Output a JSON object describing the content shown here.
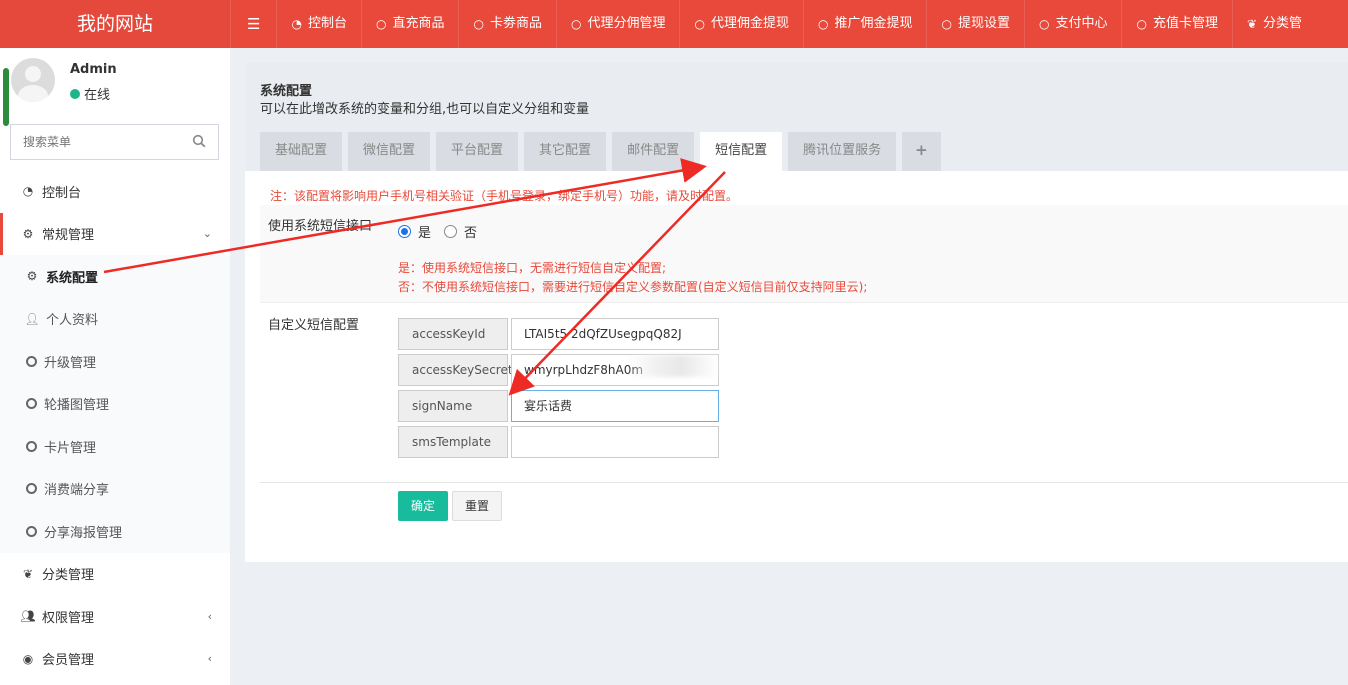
{
  "brand": "我的网站",
  "topnav": [
    {
      "icon": "dashboard",
      "label": "控制台"
    },
    {
      "icon": "circle",
      "label": "直充商品"
    },
    {
      "icon": "circle",
      "label": "卡劵商品"
    },
    {
      "icon": "circle",
      "label": "代理分佣管理"
    },
    {
      "icon": "circle",
      "label": "代理佣金提现"
    },
    {
      "icon": "circle",
      "label": "推广佣金提现"
    },
    {
      "icon": "circle",
      "label": "提现设置"
    },
    {
      "icon": "circle",
      "label": "支付中心"
    },
    {
      "icon": "circle",
      "label": "充值卡管理"
    },
    {
      "icon": "leaf",
      "label": "分类管"
    }
  ],
  "user": {
    "name": "Admin",
    "status": "在线",
    "status_color": "#20b48a"
  },
  "search": {
    "placeholder": "搜索菜单"
  },
  "sidebar": {
    "dashboard": "控制台",
    "general": "常规管理",
    "sub": [
      "系统配置",
      "个人资料",
      "升级管理",
      "轮播图管理",
      "卡片管理",
      "消费端分享",
      "分享海报管理"
    ],
    "category": "分类管理",
    "permission": "权限管理",
    "member": "会员管理"
  },
  "panel": {
    "title": "系统配置",
    "desc": "可以在此增改系统的变量和分组,也可以自定义分组和变量"
  },
  "tabs": [
    "基础配置",
    "微信配置",
    "平台配置",
    "其它配置",
    "邮件配置",
    "短信配置",
    "腾讯位置服务",
    "+"
  ],
  "form": {
    "notice": "注：该配置将影响用户手机号相关验证（手机号登录，绑定手机号）功能，请及时配置。",
    "use_system_label": "使用系统短信接口",
    "yes": "是",
    "no": "否",
    "hint_yes": "是：使用系统短信接口，无需进行短信自定义配置;",
    "hint_no": "否：不使用系统短信接口，需要进行短信自定义参数配置(自定义短信目前仅支持阿里云);",
    "custom_label": "自定义短信配置",
    "fields": [
      {
        "key": "accessKeyId",
        "value": "LTAI5t5  2dQfZUsegpqQ82J"
      },
      {
        "key": "accessKeySecret",
        "value": "  wmyrpLhdzF8hA0m"
      },
      {
        "key": "signName",
        "value": "宴乐话费"
      },
      {
        "key": "smsTemplate",
        "value": ""
      }
    ],
    "ok": "确定",
    "reset": "重置"
  },
  "colors": {
    "brand_red": "#e8493a",
    "ok_green": "#18bc9c",
    "annotation_arrow": "#ee2a24"
  }
}
